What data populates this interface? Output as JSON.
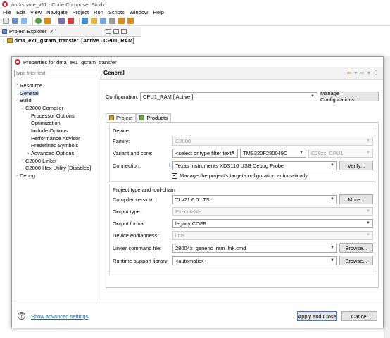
{
  "window": {
    "title": "workspace_v11 - Code Composer Studio"
  },
  "menubar": [
    "File",
    "Edit",
    "View",
    "Navigate",
    "Project",
    "Run",
    "Scripts",
    "Window",
    "Help"
  ],
  "explorer": {
    "tab_label": "Project Explorer",
    "project_name": "dma_ex1_gsram_transfer",
    "project_status": "[Active - CPU1_RAM]"
  },
  "dialog": {
    "title": "Properties for dma_ex1_gsram_transfer",
    "filter_placeholder": "type filter text",
    "tree": [
      {
        "label": "Resource",
        "indent": 0,
        "twisty": "›"
      },
      {
        "label": "General",
        "indent": 0,
        "twisty": "",
        "selected": true
      },
      {
        "label": "Build",
        "indent": 0,
        "twisty": "⌄"
      },
      {
        "label": "C2000 Compiler",
        "indent": 1,
        "twisty": "⌄"
      },
      {
        "label": "Processor Options",
        "indent": 2,
        "twisty": ""
      },
      {
        "label": "Optimization",
        "indent": 2,
        "twisty": ""
      },
      {
        "label": "Include Options",
        "indent": 2,
        "twisty": ""
      },
      {
        "label": "Performance Advisor",
        "indent": 2,
        "twisty": ""
      },
      {
        "label": "Predefined Symbols",
        "indent": 2,
        "twisty": ""
      },
      {
        "label": "Advanced Options",
        "indent": 2,
        "twisty": "›"
      },
      {
        "label": "C2000 Linker",
        "indent": 1,
        "twisty": "›"
      },
      {
        "label": "C2000 Hex Utility  [Disabled]",
        "indent": 1,
        "twisty": ""
      },
      {
        "label": "Debug",
        "indent": 0,
        "twisty": "›"
      }
    ],
    "section_title": "General",
    "configuration_label": "Configuration:",
    "configuration_value": "CPU1_RAM  [ Active ]",
    "manage_button": "Manage Configurations...",
    "tabs": [
      "Project",
      "Products"
    ],
    "device": {
      "title": "Device",
      "family_label": "Family:",
      "family_value": "C2000",
      "variant_label": "Variant and core:",
      "variant_filter": "<select or type filter text>",
      "variant_value": "TMS320F280049C",
      "core_value": "C28xx_CPU1",
      "connection_label": "Connection:",
      "connection_value": "Texas Instruments XDS110 USB Debug Probe",
      "verify_button": "Verify...",
      "manage_checkbox_label": "Manage the project's target-configuration automatically"
    },
    "toolchain": {
      "title": "Project type and tool-chain",
      "compiler_label": "Compiler version:",
      "compiler_value": "TI v21.6.0.LTS",
      "more_button": "More...",
      "output_type_label": "Output type:",
      "output_type_value": "Executable",
      "output_format_label": "Output format:",
      "output_format_value": "legacy COFF",
      "endianness_label": "Device endianness:",
      "endianness_value": "little",
      "linker_label": "Linker command file:",
      "linker_value": "28004x_generic_ram_lnk.cmd",
      "browse_button": "Browse...",
      "runtime_label": "Runtime support library:",
      "runtime_value": "<automatic>",
      "browse_button2": "Browse..."
    },
    "footer": {
      "help_symbol": "?",
      "advanced_link": "Show advanced settings",
      "apply_close_button": "Apply and Close",
      "cancel_button": "Cancel"
    }
  },
  "colors": {
    "accent": "#1a5fb4",
    "selection": "#d9e9f8"
  }
}
